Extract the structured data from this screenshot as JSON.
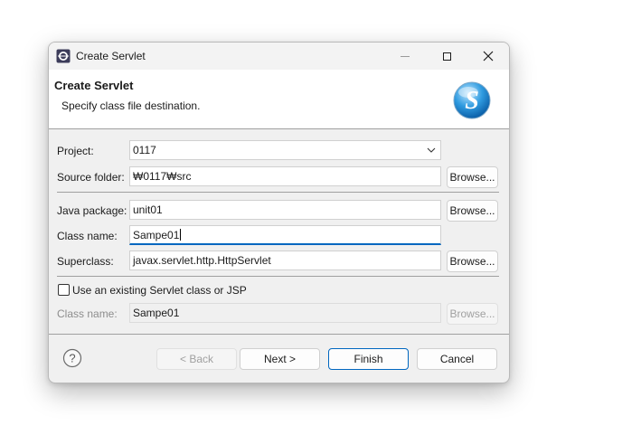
{
  "window": {
    "title": "Create Servlet",
    "icons": {
      "app": "eclipse-icon",
      "minimize": "minimize-icon",
      "maximize": "maximize-icon",
      "close": "close-icon"
    }
  },
  "banner": {
    "title": "Create Servlet",
    "description": "Specify class file destination.",
    "logo": "servlet-logo-icon"
  },
  "form": {
    "project_label": "Project:",
    "project_value": "0117",
    "source_folder_label": "Source folder:",
    "source_folder_value": "₩0117₩src",
    "java_package_label": "Java package:",
    "java_package_value": "unit01",
    "class_name_label": "Class name:",
    "class_name_value": "Sampe01",
    "superclass_label": "Superclass:",
    "superclass_value": "javax.servlet.http.HttpServlet",
    "browse_label": "Browse...",
    "use_existing_label": "Use an existing Servlet class or JSP",
    "use_existing_checked": false,
    "existing_class_label": "Class name:",
    "existing_class_value": "Sampe01"
  },
  "footer": {
    "back_label": "< Back",
    "next_label": "Next >",
    "finish_label": "Finish",
    "cancel_label": "Cancel",
    "help_icon": "help-icon"
  },
  "colors": {
    "accent": "#0067c0",
    "background": "#f0f0f0"
  }
}
